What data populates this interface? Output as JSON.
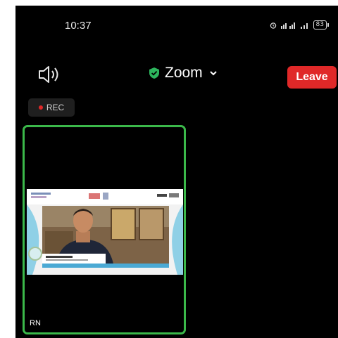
{
  "status_bar": {
    "time": "10:37",
    "icons": [
      "alarm-icon",
      "signal-icon",
      "wifi-icon"
    ],
    "network_text": "ᐤ",
    "battery_level": "83"
  },
  "top_bar": {
    "title": "Zoom",
    "leave_label": "Leave",
    "leave_color": "#e02828",
    "shield_color": "#2db55d"
  },
  "recording": {
    "label": "REC"
  },
  "participant": {
    "initials": "RN",
    "border_color": "#3bb84a"
  }
}
